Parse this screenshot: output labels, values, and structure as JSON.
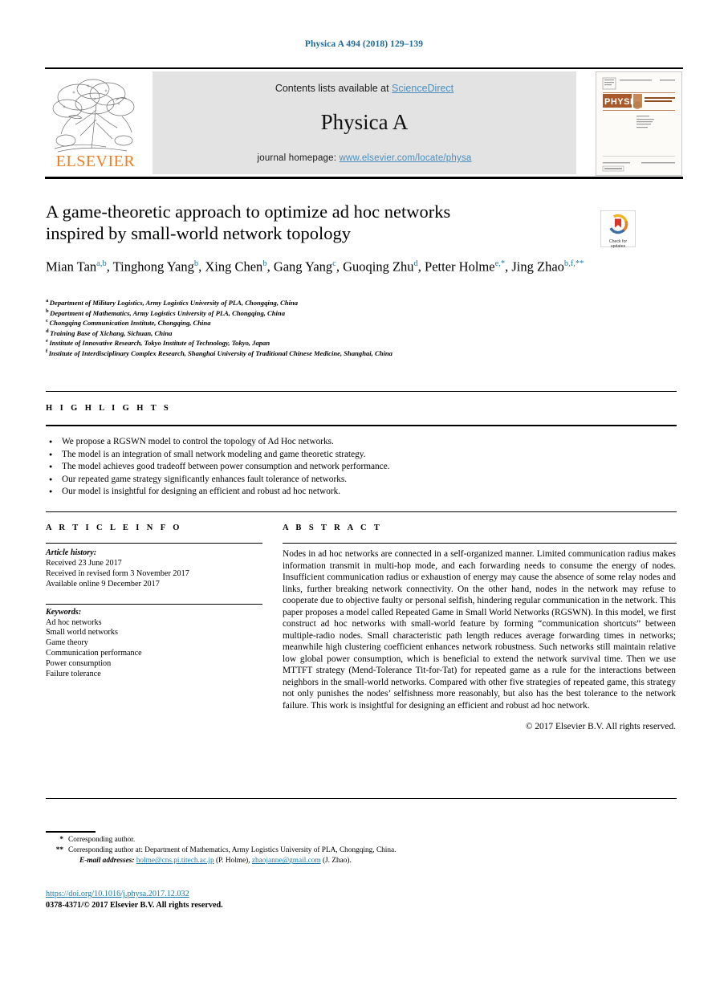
{
  "running_head": "Physica A 494 (2018) 129–139",
  "masthead": {
    "contents_prefix": "Contents lists available at ",
    "sciencedirect": "ScienceDirect",
    "journal_name": "Physica A",
    "homepage_prefix": "journal homepage: ",
    "homepage_url": "www.elsevier.com/locate/physa",
    "publisher_logo_text": "ELSEVIER",
    "cover": {
      "title": "PHYSICA",
      "subtitle_line1": "STATISTICAL MECHANICS",
      "subtitle_line2": "AND ITS APPLICATIONS"
    }
  },
  "article": {
    "title_line1": "A game-theoretic approach to optimize ad hoc networks",
    "title_line2": "inspired by small-world network topology",
    "authors": [
      {
        "name": "Mian Tan",
        "sup": "a,b"
      },
      {
        "name": "Tinghong Yang",
        "sup": "b"
      },
      {
        "name": "Xing Chen",
        "sup": "b"
      },
      {
        "name": "Gang Yang",
        "sup": "c"
      },
      {
        "name": "Guoqing Zhu",
        "sup": "d"
      },
      {
        "name": "Petter Holme",
        "sup": "e,*"
      },
      {
        "name": "Jing Zhao",
        "sup": "b,f,**"
      }
    ],
    "affiliations": [
      {
        "label": "a",
        "text": "Department of Military Logistics, Army Logistics University of PLA, Chongqing, China"
      },
      {
        "label": "b",
        "text": "Department of Mathematics, Army Logistics University of PLA, Chongqing, China"
      },
      {
        "label": "c",
        "text": "Chongqing Communication Institute, Chongqing, China"
      },
      {
        "label": "d",
        "text": "Training Base of Xichang, Sichuan, China"
      },
      {
        "label": "e",
        "text": "Institute of Innovative Research, Tokyo Institute of Technology, Tokyo, Japan"
      },
      {
        "label": "f",
        "text": "Institute of Interdisciplinary Complex Research, Shanghai University of Traditional Chinese Medicine, Shanghai, China"
      }
    ],
    "crossmark_label_line1": "Check for",
    "crossmark_label_line2": "updates"
  },
  "highlights": {
    "heading": "H I G H L I G H T S",
    "items": [
      "We propose a RGSWN model to control the topology of Ad Hoc networks.",
      "The model is an integration of small network modeling and game theoretic strategy.",
      "The model achieves good tradeoff between power consumption and network performance.",
      "Our repeated game strategy significantly enhances fault tolerance of networks.",
      "Our model is insightful for designing an efficient and robust ad hoc network."
    ]
  },
  "article_info": {
    "heading": "A R T I C L E   I N F O",
    "history_label": "Article history:",
    "history": [
      "Received 23 June 2017",
      "Received in revised form 3 November 2017",
      "Available online 9 December 2017"
    ],
    "keywords_label": "Keywords:",
    "keywords": [
      "Ad hoc networks",
      "Small world networks",
      "Game theory",
      "Communication performance",
      "Power consumption",
      "Failure tolerance"
    ]
  },
  "abstract": {
    "heading": "A B S T R A C T",
    "text": "Nodes in ad hoc networks are connected in a self-organized manner. Limited communication radius makes information transmit in multi-hop mode, and each forwarding needs to consume the energy of nodes. Insufficient communication radius or exhaustion of energy may cause the absence of some relay nodes and links, further breaking network connectivity. On the other hand, nodes in the network may refuse to cooperate due to objective faulty or personal selfish, hindering regular communication in the network. This paper proposes a model called Repeated Game in Small World Networks (RGSWN). In this model, we first construct ad hoc networks with small-world feature by forming “communication shortcuts” between multiple-radio nodes. Small characteristic path length reduces average forwarding times in networks; meanwhile high clustering coefficient enhances network robustness. Such networks still maintain relative low global power consumption, which is beneficial to extend the network survival time. Then we use MTTFT strategy (Mend-Tolerance Tit-for-Tat) for repeated game as a rule for the interactions between neighbors in the small-world networks. Compared with other five strategies of repeated game, this strategy not only punishes the nodes’ selfishness more reasonably, but also has the best tolerance to the network failure. This work is insightful for designing an efficient and robust ad hoc network.",
    "copyright": "© 2017 Elsevier B.V. All rights reserved."
  },
  "footnotes": {
    "single_star_mark": "*",
    "single_star_text": "Corresponding author.",
    "double_star_mark": "**",
    "double_star_text": "Corresponding author at: Department of Mathematics, Army Logistics University of PLA, Chongqing, China.",
    "email_label": "E-mail addresses:",
    "email_1": "holme@cns.pi.titech.ac.jp",
    "email_1_owner": " (P. Holme), ",
    "email_2": "zhaojanne@gmail.com",
    "email_2_owner": " (J. Zhao)."
  },
  "footer": {
    "doi": "https://doi.org/10.1016/j.physa.2017.12.032",
    "issn_line": "0378-4371/© 2017 Elsevier B.V. All rights reserved."
  }
}
